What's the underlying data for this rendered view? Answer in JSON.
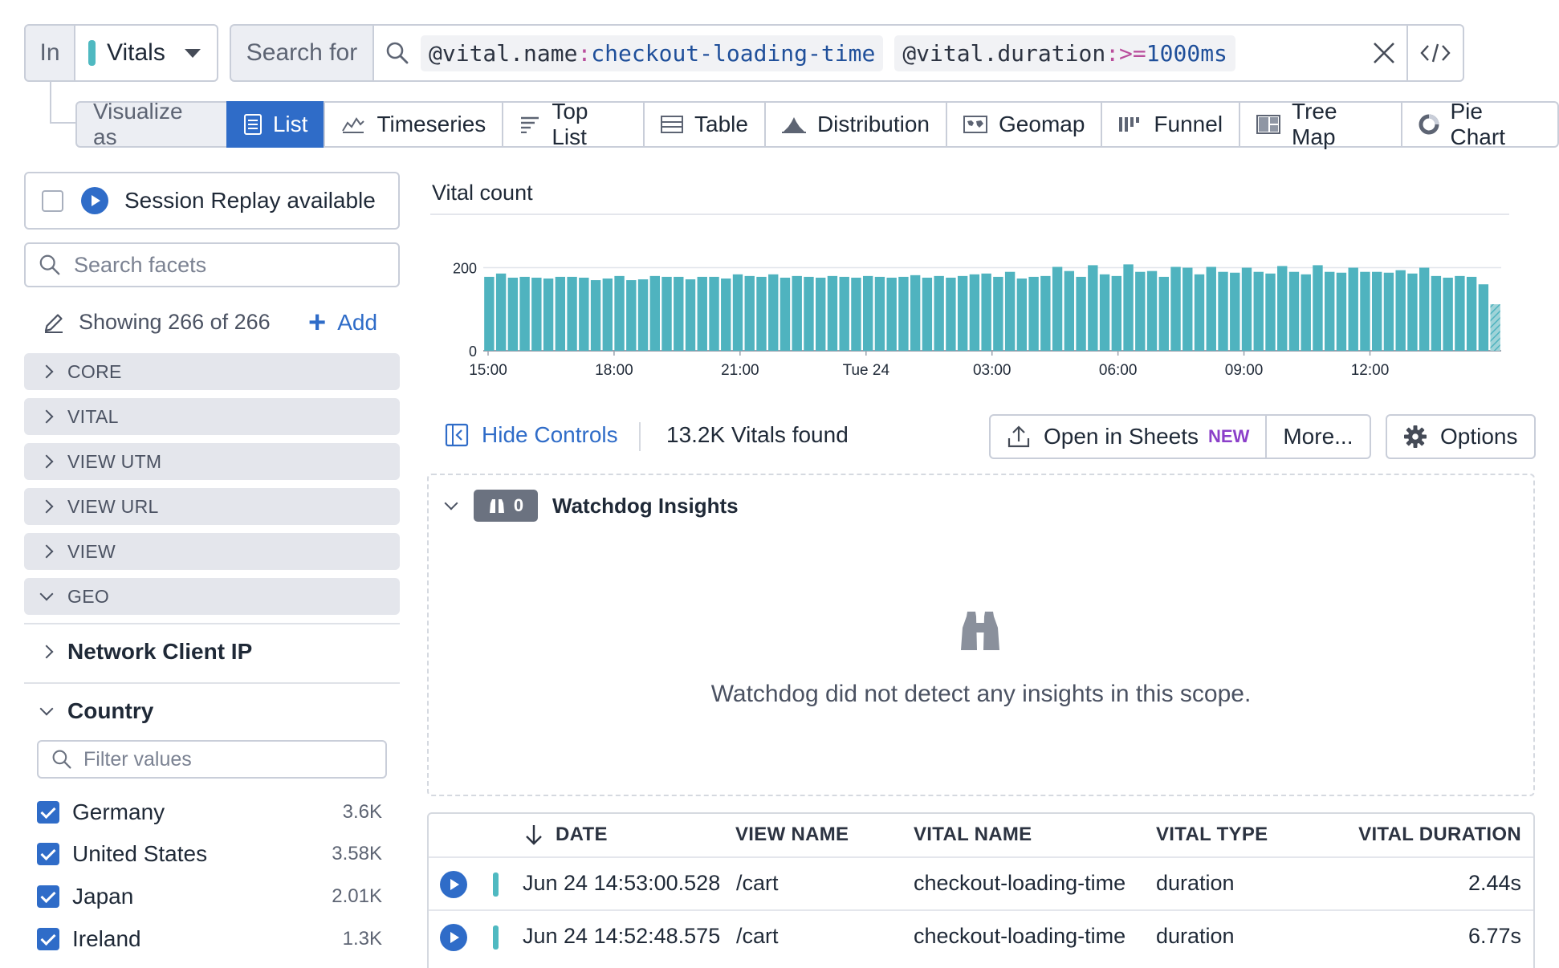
{
  "query": {
    "in_label": "In",
    "source": "Vitals",
    "search_for_label": "Search for",
    "tokens": [
      {
        "key": "@vital.name",
        "op": ":",
        "value": "checkout-loading-time"
      },
      {
        "key": "@vital.duration",
        "op": ":>=",
        "value": "1000ms"
      }
    ]
  },
  "visualize": {
    "label": "Visualize as",
    "options": [
      "List",
      "Timeseries",
      "Top List",
      "Table",
      "Distribution",
      "Geomap",
      "Funnel",
      "Tree Map",
      "Pie Chart"
    ],
    "active": "List"
  },
  "sidebar": {
    "session_replay_label": "Session Replay available",
    "search_placeholder": "Search facets",
    "showing": "Showing 266 of 266",
    "add_label": "Add",
    "groups": [
      "CORE",
      "VITAL",
      "VIEW UTM",
      "VIEW URL",
      "VIEW",
      "GEO"
    ],
    "network_client_ip": "Network Client IP",
    "country": {
      "title": "Country",
      "filter_placeholder": "Filter values",
      "items": [
        {
          "name": "Germany",
          "count": "3.6K"
        },
        {
          "name": "United States",
          "count": "3.58K"
        },
        {
          "name": "Japan",
          "count": "2.01K"
        },
        {
          "name": "Ireland",
          "count": "1.3K"
        }
      ]
    }
  },
  "chart_data": {
    "type": "bar",
    "title": "Vital count",
    "x_tick_labels": [
      "15:00",
      "18:00",
      "21:00",
      "Tue 24",
      "03:00",
      "06:00",
      "09:00",
      "12:00"
    ],
    "y_ticks": [
      0,
      200
    ],
    "ylim": [
      0,
      230
    ],
    "color": "#4fb3bf",
    "grid": true,
    "values": [
      178,
      186,
      176,
      178,
      176,
      174,
      178,
      178,
      176,
      170,
      174,
      180,
      170,
      172,
      180,
      178,
      178,
      172,
      178,
      178,
      174,
      184,
      180,
      178,
      184,
      176,
      180,
      178,
      176,
      180,
      178,
      176,
      180,
      178,
      176,
      178,
      182,
      176,
      180,
      176,
      180,
      184,
      186,
      178,
      190,
      174,
      178,
      180,
      202,
      192,
      178,
      206,
      184,
      180,
      208,
      190,
      192,
      178,
      202,
      200,
      184,
      202,
      190,
      188,
      200,
      190,
      186,
      204,
      190,
      184,
      206,
      190,
      188,
      200,
      190,
      190,
      188,
      194,
      186,
      200,
      180,
      176,
      180,
      178,
      160,
      112
    ],
    "last_bar_partial": true
  },
  "controls": {
    "hide_controls": "Hide Controls",
    "found": "13.2K Vitals found",
    "open_in_sheets": "Open in Sheets",
    "new_badge": "NEW",
    "more": "More...",
    "options": "Options"
  },
  "watchdog": {
    "count": "0",
    "title": "Watchdog Insights",
    "message": "Watchdog did not detect any insights in this scope."
  },
  "table": {
    "columns": [
      "DATE",
      "VIEW NAME",
      "VITAL NAME",
      "VITAL TYPE",
      "VITAL DURATION"
    ],
    "rows": [
      {
        "date": "Jun 24 14:53:00.528",
        "view_name": "/cart",
        "vital_name": "checkout-loading-time",
        "vital_type": "duration",
        "vital_duration": "2.44s"
      },
      {
        "date": "Jun 24 14:52:48.575",
        "view_name": "/cart",
        "vital_name": "checkout-loading-time",
        "vital_type": "duration",
        "vital_duration": "6.77s"
      }
    ]
  },
  "colors": {
    "accent": "#2f6cc8",
    "vital_teal": "#4fb9c1",
    "operator_pink": "#b94d9c",
    "new_badge_purple": "#8b3fc9"
  }
}
